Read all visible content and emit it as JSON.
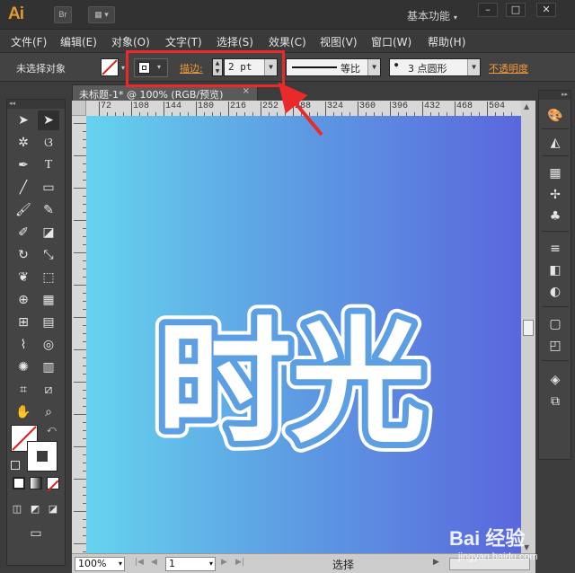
{
  "app": {
    "logo": "Ai",
    "bridge_label": "Br",
    "workspace_label": "基本功能",
    "window_controls": [
      "–",
      "□",
      "✕"
    ]
  },
  "menu": {
    "items": [
      "文件(F)",
      "编辑(E)",
      "对象(O)",
      "文字(T)",
      "选择(S)",
      "效果(C)",
      "视图(V)",
      "窗口(W)",
      "帮助(H)"
    ]
  },
  "control_bar": {
    "selection_label": "未选择对象",
    "stroke_label": "描边:",
    "stroke_value": "2 pt",
    "profile_label": "等比",
    "brush_label": "3 点圆形",
    "opacity_label": "不透明度"
  },
  "document": {
    "tab_title": "未标题-1* @ 100% (RGB/预览)",
    "close_label": "×"
  },
  "ruler": {
    "labels": [
      "72",
      "108",
      "144",
      "180",
      "216",
      "252",
      "288",
      "324",
      "360",
      "396",
      "432",
      "468",
      "504"
    ]
  },
  "artwork": {
    "text": "时光",
    "fill_color": "#ffffff",
    "outline_color": "#ffffff",
    "gradient_colors": [
      "#66d3ee",
      "#5d9fe3",
      "#5a67dd"
    ]
  },
  "status_bar": {
    "zoom": "100%",
    "page": "1",
    "mode": "选择"
  },
  "annotation": {
    "highlight_color": "#ea2a2a"
  },
  "watermark": {
    "text": "Bai 经验",
    "url": "jingyan.baidu.com"
  }
}
